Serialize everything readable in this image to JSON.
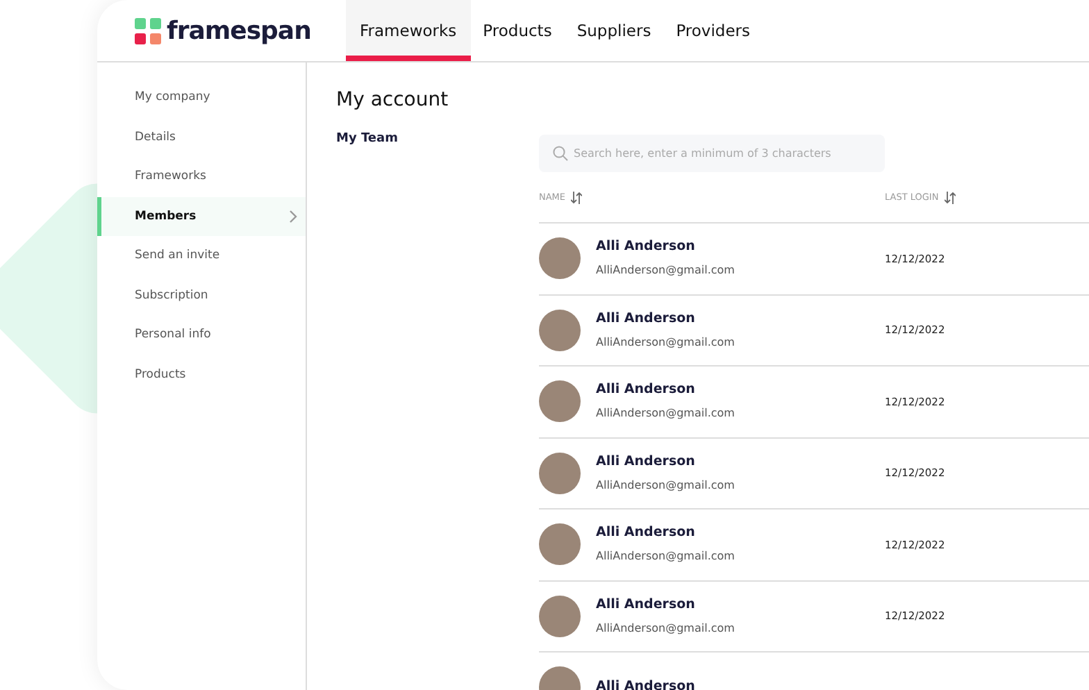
{
  "logo": {
    "text": "framespan"
  },
  "nav": [
    {
      "label": "Frameworks",
      "selected": true
    },
    {
      "label": "Products",
      "selected": false
    },
    {
      "label": "Suppliers",
      "selected": false
    },
    {
      "label": "Providers",
      "selected": false
    }
  ],
  "sidebar": {
    "items": [
      {
        "label": "My company",
        "selected": false
      },
      {
        "label": "Details",
        "selected": false
      },
      {
        "label": "Frameworks",
        "selected": false
      },
      {
        "label": "Members",
        "selected": true
      },
      {
        "label": "Send an invite",
        "selected": false
      },
      {
        "label": "Subscription",
        "selected": false
      },
      {
        "label": "Personal info",
        "selected": false
      },
      {
        "label": "Products",
        "selected": false
      }
    ]
  },
  "page_title": "My account",
  "section_title": "My Team",
  "search": {
    "placeholder": "Search here, enter a minimum of 3 characters"
  },
  "table": {
    "columns": [
      "NAME",
      "LAST LOGIN"
    ],
    "rows": [
      {
        "name": "Alli Anderson",
        "email": "AlliAnderson@gmail.com",
        "last_login": "12/12/2022"
      },
      {
        "name": "Alli Anderson",
        "email": "AlliAnderson@gmail.com",
        "last_login": "12/12/2022"
      },
      {
        "name": "Alli Anderson",
        "email": "AlliAnderson@gmail.com",
        "last_login": "12/12/2022"
      },
      {
        "name": "Alli Anderson",
        "email": "AlliAnderson@gmail.com",
        "last_login": "12/12/2022"
      },
      {
        "name": "Alli Anderson",
        "email": "AlliAnderson@gmail.com",
        "last_login": "12/12/2022"
      },
      {
        "name": "Alli Anderson",
        "email": "AlliAnderson@gmail.com",
        "last_login": "12/12/2022"
      },
      {
        "name": "Alli Anderson"
      }
    ]
  }
}
